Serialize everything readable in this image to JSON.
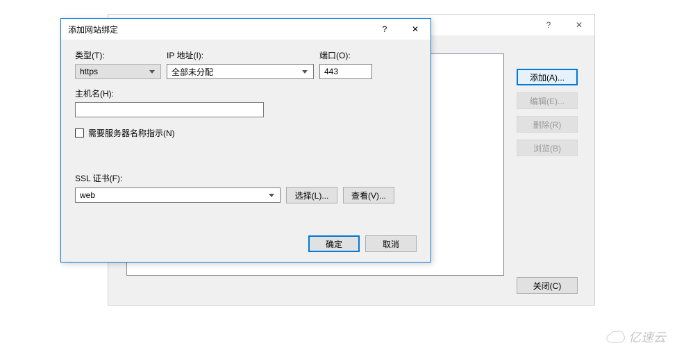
{
  "back": {
    "help_glyph": "?",
    "close_glyph": "✕",
    "buttons": {
      "add": "添加(A)...",
      "edit": "编辑(E)...",
      "remove": "删除(R)",
      "browse": "浏览(B)"
    },
    "close": "关闭(C)"
  },
  "front": {
    "title": "添加网站绑定",
    "help_glyph": "?",
    "close_glyph": "✕",
    "labels": {
      "type": "类型(T):",
      "ip": "IP 地址(I):",
      "port": "端口(O):",
      "host": "主机名(H):",
      "sni": "需要服务器名称指示(N)",
      "ssl": "SSL 证书(F):"
    },
    "values": {
      "type": "https",
      "ip": "全部未分配",
      "port": "443",
      "host": "",
      "ssl": "web"
    },
    "buttons": {
      "select": "选择(L)...",
      "view": "查看(V)...",
      "ok": "确定",
      "cancel": "取消"
    }
  },
  "watermark": "亿速云"
}
